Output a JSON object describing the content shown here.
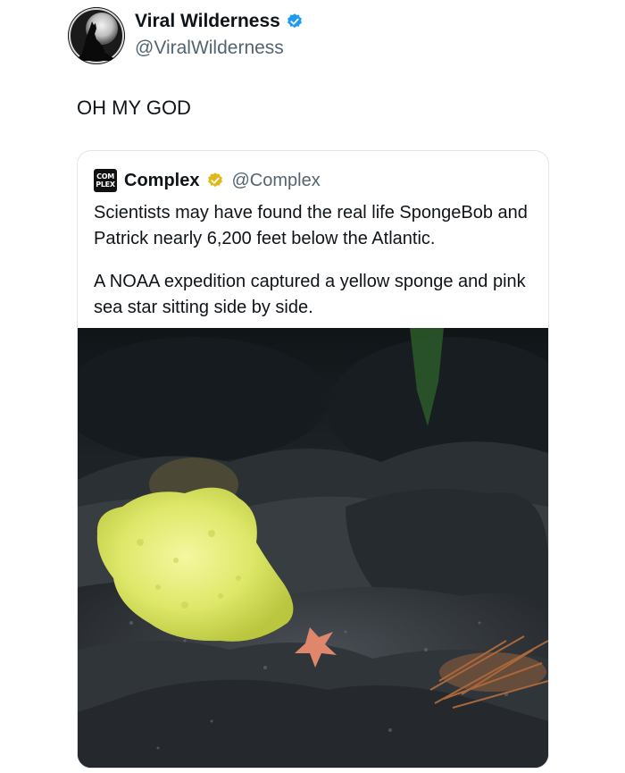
{
  "author": {
    "display_name": "Viral Wilderness",
    "handle": "@ViralWilderness",
    "avatar_icon": "wolf-howling-moon-icon",
    "verified_color": "#1d9bf0"
  },
  "post": {
    "text": "OH MY GOD"
  },
  "quoted_post": {
    "logo_line1": "COM",
    "logo_line2": "PLEX",
    "display_name": "Complex",
    "handle": "@Complex",
    "verified_color": "#e2b719",
    "paragraph1": "Scientists may have found the real life SpongeBob and Patrick nearly 6,200 feet below the Atlantic.",
    "paragraph2": "A NOAA expedition captured a yellow sponge and pink sea star sitting side by side."
  },
  "media": {
    "subject": "yellow sponge and pink sea star on dark seafloor"
  }
}
